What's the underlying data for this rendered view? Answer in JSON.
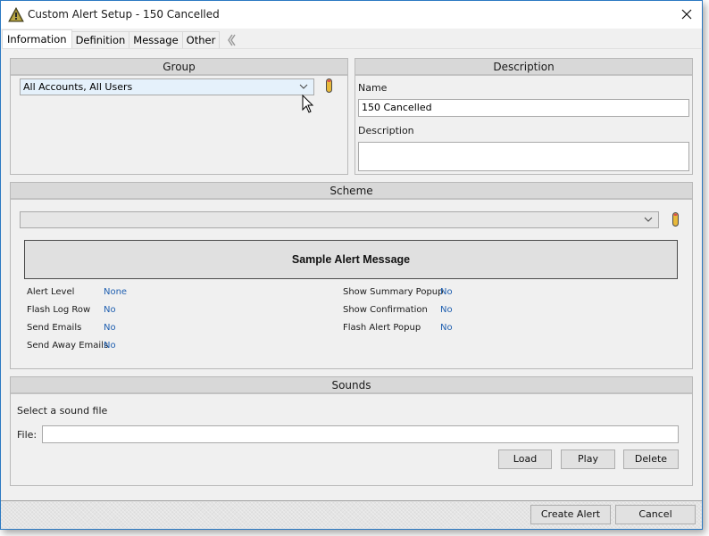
{
  "window": {
    "title": "Custom Alert Setup - 150 Cancelled",
    "title_icon": "warning-triangle-icon",
    "close_icon": "close-icon"
  },
  "tabs": [
    {
      "label": "Information",
      "active": true
    },
    {
      "label": "Definition",
      "active": false
    },
    {
      "label": "Message",
      "active": false
    },
    {
      "label": "Other",
      "active": false
    }
  ],
  "tab_scroll_icon": "double-chevron-left-icon",
  "group": {
    "header": "Group",
    "selected": "All Accounts, All Users",
    "edit_icon": "pill-edit-icon"
  },
  "description": {
    "header": "Description",
    "name_label": "Name",
    "name_value": "150 Cancelled",
    "description_label": "Description",
    "description_value": ""
  },
  "scheme": {
    "header": "Scheme",
    "selected": "",
    "edit_icon": "pill-edit-icon",
    "sample_message": "Sample Alert Message",
    "left_props": [
      {
        "label": "Alert Level",
        "value": "None"
      },
      {
        "label": "Flash Log Row",
        "value": "No"
      },
      {
        "label": "Send Emails",
        "value": "No"
      },
      {
        "label": "Send Away Emails",
        "value": "No"
      }
    ],
    "right_props": [
      {
        "label": "Show Summary Popup",
        "value": "No"
      },
      {
        "label": "Show Confirmation",
        "value": "No"
      },
      {
        "label": "Flash Alert Popup",
        "value": "No"
      }
    ],
    "value_color": "#1f5fb0"
  },
  "sounds": {
    "header": "Sounds",
    "prompt": "Select a sound file",
    "file_label": "File:",
    "file_value": "",
    "load_label": "Load",
    "play_label": "Play",
    "delete_label": "Delete"
  },
  "footer": {
    "create_label": "Create Alert",
    "cancel_label": "Cancel"
  },
  "colors": {
    "window_border": "#2b79c2",
    "panel_header": "#d8d8d8",
    "combo_highlight": "#e5f1fb",
    "pill_body": "#e8b93a",
    "pill_tip": "#d9534f"
  }
}
